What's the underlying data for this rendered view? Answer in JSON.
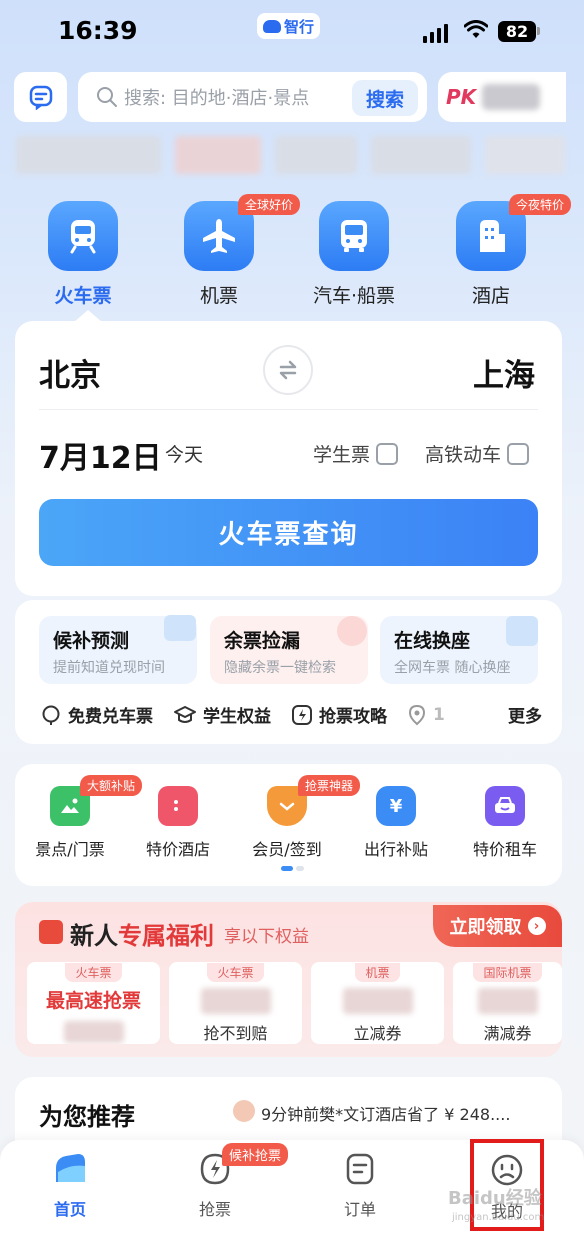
{
  "status_bar": {
    "time": "16:39",
    "app_name": "智行",
    "battery": "82"
  },
  "header": {
    "search_placeholder": "搜索: 目的地·酒店·景点",
    "search_button": "搜索",
    "pk_label": "PK"
  },
  "categories": [
    {
      "label": "火车票",
      "icon": "train-icon",
      "tag": ""
    },
    {
      "label": "机票",
      "icon": "plane-icon",
      "tag": "全球好价"
    },
    {
      "label": "汽车·船票",
      "icon": "bus-icon",
      "tag": ""
    },
    {
      "label": "酒店",
      "icon": "hotel-icon",
      "tag": "今夜特价"
    }
  ],
  "train": {
    "from": "北京",
    "to": "上海",
    "date": "7月12日",
    "day_label": "今天",
    "student_label": "学生票",
    "highspeed_label": "高铁动车",
    "query_button": "火车票查询"
  },
  "features": [
    {
      "title": "候补预测",
      "sub": "提前知道兑现时间"
    },
    {
      "title": "余票捡漏",
      "sub": "隐藏余票一键检索"
    },
    {
      "title": "在线换座",
      "sub": "全网车票 随心换座"
    }
  ],
  "links": [
    {
      "label": "免费兑车票",
      "icon": "ticket-exchange-icon"
    },
    {
      "label": "学生权益",
      "icon": "graduation-cap-icon"
    },
    {
      "label": "抢票攻略",
      "icon": "lightning-icon"
    },
    {
      "label": "1",
      "icon": "location-icon"
    }
  ],
  "more_label": "更多",
  "services": [
    {
      "label": "景点/门票",
      "icon": "scenic-icon",
      "tag": "大额补贴",
      "color": "#3cc068"
    },
    {
      "label": "特价酒店",
      "icon": "hotel-deal-icon",
      "tag": "",
      "color": "#f0566a"
    },
    {
      "label": "会员/签到",
      "icon": "member-icon",
      "tag": "抢票神器",
      "color": "#f59a3a"
    },
    {
      "label": "出行补贴",
      "icon": "subsidy-icon",
      "tag": "",
      "color": "#3b8cf5"
    },
    {
      "label": "特价租车",
      "icon": "car-rental-icon",
      "tag": "",
      "color": "#7a5cf0"
    }
  ],
  "newuser": {
    "title_a": "新人",
    "title_b": "专属福利",
    "subtitle": "享以下权益",
    "claim": "立即领取",
    "coupons": [
      {
        "tag": "火车票",
        "main": "最高速抢票",
        "name": ""
      },
      {
        "tag": "火车票",
        "main": "",
        "name": "抢不到赔"
      },
      {
        "tag": "机票",
        "main": "",
        "name": "立减券"
      },
      {
        "tag": "国际机票",
        "main": "",
        "name": "满减券"
      }
    ]
  },
  "recommend": {
    "title": "为您推荐",
    "note": "9分钟前樊*文订酒店省了 ¥ 248...."
  },
  "tabs": [
    {
      "label": "首页",
      "icon": "home-icon",
      "tag": ""
    },
    {
      "label": "抢票",
      "icon": "grab-ticket-icon",
      "tag": "候补抢票"
    },
    {
      "label": "订单",
      "icon": "order-icon",
      "tag": ""
    },
    {
      "label": "我的",
      "icon": "profile-icon",
      "tag": ""
    }
  ],
  "watermark": {
    "line1": "Baidu经验",
    "line2": "jingyan.baidu.com"
  },
  "colors": {
    "accent": "#2b6bf0",
    "tag_red": "#f25a4a",
    "highlight": "#e21b1b"
  }
}
